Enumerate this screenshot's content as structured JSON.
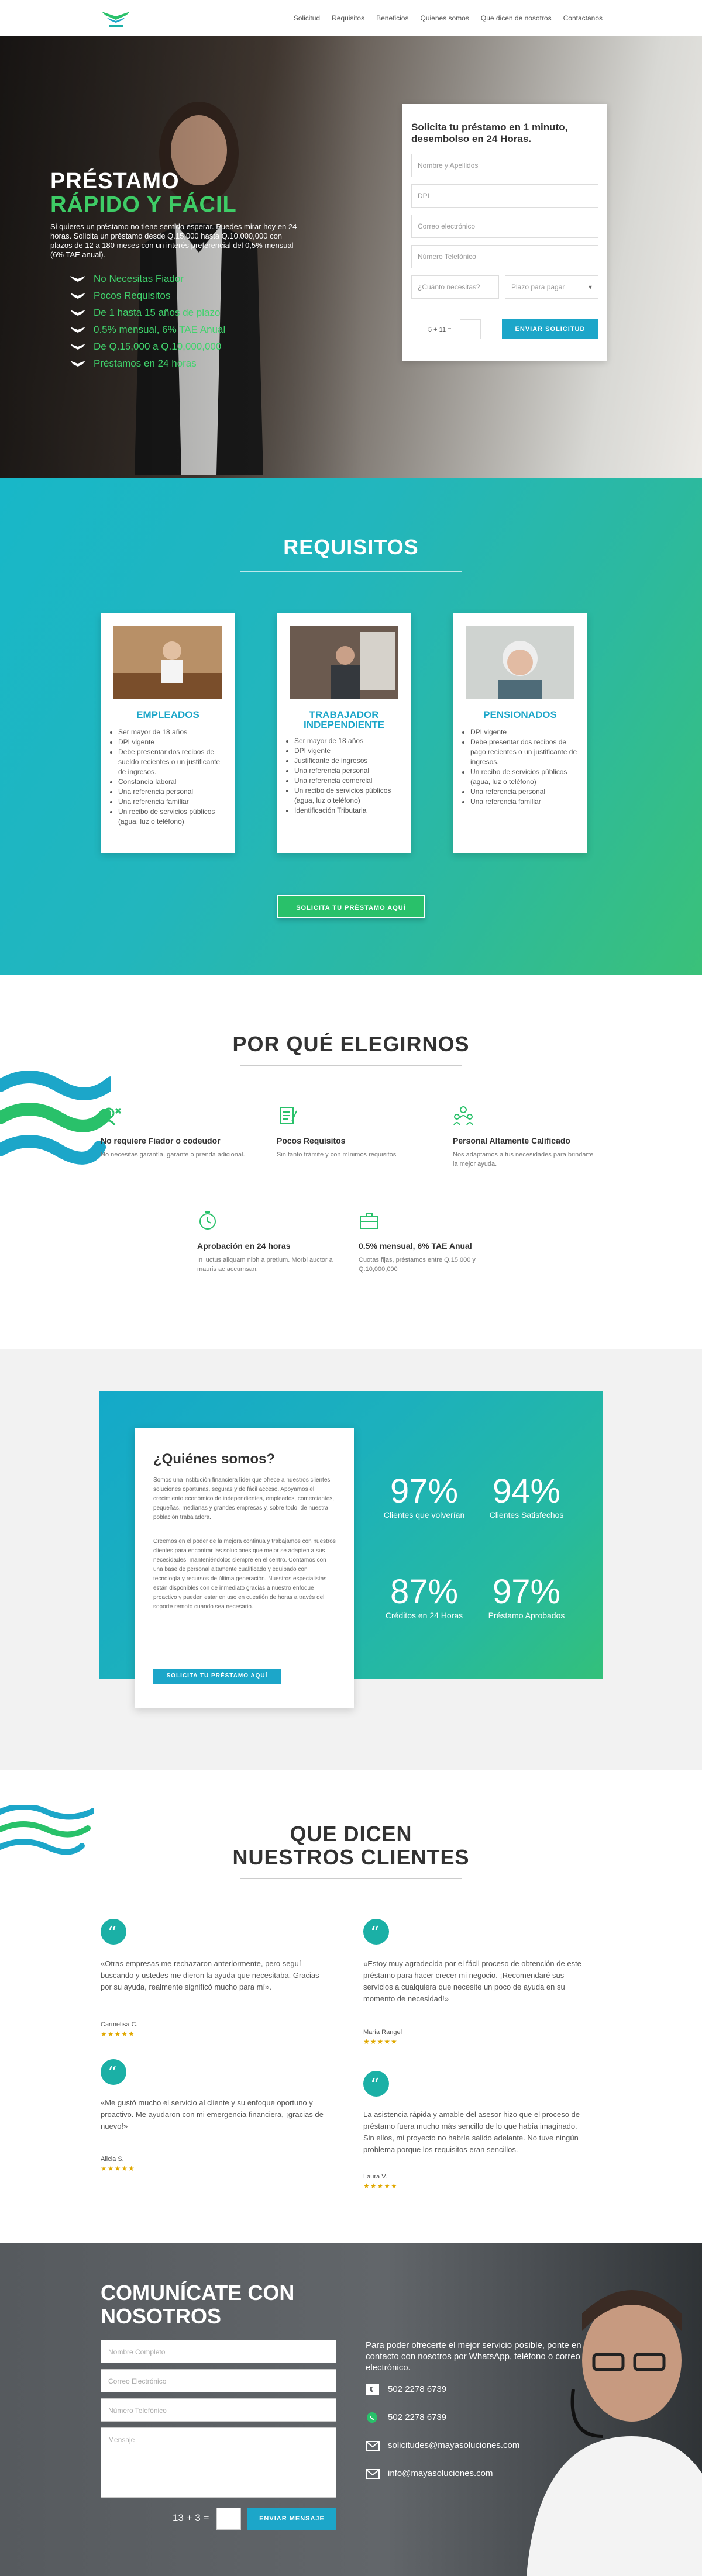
{
  "colors": {
    "green": "#29c16a",
    "teal": "#1ca6c9",
    "accent": "#1bb0a6"
  },
  "nav": {
    "items": [
      "Solicitud",
      "Requisitos",
      "Beneficios",
      "Quienes somos",
      "Que dicen de nosotros",
      "Contactanos"
    ]
  },
  "hero": {
    "title_line1": "PRÉSTAMO",
    "title_line2": "RÁPIDO Y FÁCIL",
    "intro": "Si quieres un préstamo no tiene sentido esperar. Puedes mirar hoy en 24 horas. Solicita un préstamo desde Q.15,000 hasta Q.10,000,000 con plazos de 12 a 180 meses con un interés preferencial del 0,5% mensual (6% TAE anual).",
    "bullets": [
      "No Necesitas Fiador",
      "Pocos Requisitos",
      "De 1 hasta 15 años de plazo",
      "0.5% mensual, 6% TAE Anual",
      "De Q.15,000 a Q.10,000,000",
      "Préstamos en 24 horas"
    ]
  },
  "form": {
    "title": "Solicita tu préstamo en 1 minuto, desembolso en 24 Horas.",
    "name_placeholder": "Nombre y Apellidos",
    "dpi_placeholder": "DPI",
    "email_placeholder": "Correo electrónico",
    "phone_placeholder": "Número Telefónico",
    "amount_placeholder": "¿Cuánto necesitas?",
    "term_placeholder": "Plazo para pagar",
    "captcha": "5 + 11 =",
    "submit": "ENVIAR SOLICITUD"
  },
  "requisitos": {
    "title": "REQUISITOS",
    "cards": [
      {
        "title": "EMPLEADOS",
        "items": [
          "Ser mayor de 18 años",
          "DPI vigente",
          "Debe presentar dos recibos de sueldo recientes o un justificante de ingresos.",
          "Constancia laboral",
          "Una referencia personal",
          "Una referencia familiar",
          "Un recibo de servicios públicos (agua, luz o teléfono)"
        ]
      },
      {
        "title": "TRABAJADOR INDEPENDIENTE",
        "items": [
          "Ser mayor de 18 años",
          "DPI vigente",
          "Justificante de ingresos",
          "Una referencia personal",
          "Una referencia comercial",
          "Un recibo de servicios públicos (agua, luz o teléfono)",
          "Identificación Tributaria"
        ]
      },
      {
        "title": "PENSIONADOS",
        "items": [
          "DPI vigente",
          "Debe presentar dos recibos de pago recientes o un justificante de ingresos.",
          "Un recibo de servicios públicos (agua, luz o teléfono)",
          "Una referencia personal",
          "Una referencia familiar"
        ]
      }
    ],
    "cta": "SOLICITA TU PRÉSTAMO AQUÍ"
  },
  "why": {
    "title": "POR QUÉ ELEGIRNOS",
    "features": [
      {
        "icon": "no-guarantor-icon",
        "title": "No requiere Fiador o codeudor",
        "text": "No necesitas garantía, garante o prenda adicional."
      },
      {
        "icon": "document-icon",
        "title": "Pocos Requisitos",
        "text": "Sin tanto trámite y con mínimos requisitos"
      },
      {
        "icon": "team-icon",
        "title": "Personal Altamente Calificado",
        "text": "Nos adaptamos a tus necesidades para brindarte la mejor ayuda."
      },
      {
        "icon": "clock-icon",
        "title": "Aprobación en 24 horas",
        "text": "In luctus aliquam nibh a pretium. Morbi auctor a mauris ac accumsan."
      },
      {
        "icon": "briefcase-icon",
        "title": "0.5% mensual, 6% TAE Anual",
        "text": "Cuotas fijas, préstamos entre Q.15,000 y Q.10,000,000"
      }
    ]
  },
  "about": {
    "title": "¿Quiénes somos?",
    "p1": "Somos una institución financiera líder que ofrece a nuestros clientes soluciones oportunas, seguras y de fácil acceso. Apoyamos el crecimiento económico de independientes, empleados, comerciantes, pequeñas, medianas y grandes empresas y, sobre todo, de nuestra población trabajadora.",
    "p2": "Creemos en el poder de la mejora continua y trabajamos con nuestros clientes para encontrar las soluciones que mejor se adapten a sus necesidades, manteniéndolos siempre en el centro. Contamos con una base de personal altamente cualificado y equipado con tecnología y recursos de última generación. Nuestros especialistas están disponibles con de inmediato gracias a nuestro enfoque proactivo y pueden estar en uso en cuestión de horas a través del soporte remoto cuando sea necesario.",
    "cta": "SOLICITA TU PRÉSTAMO AQUÍ",
    "stats": [
      {
        "value": "97%",
        "label": "Clientes que volverían"
      },
      {
        "value": "94%",
        "label": "Clientes Satisfechos"
      },
      {
        "value": "87%",
        "label": "Créditos en 24 Horas"
      },
      {
        "value": "97%",
        "label": "Préstamo Aprobados"
      }
    ]
  },
  "testimonials": {
    "title_line1": "QUE DICEN",
    "title_line2": "NUESTROS CLIENTES",
    "items": [
      {
        "quote": "«Otras empresas me rechazaron anteriormente, pero seguí buscando y ustedes me dieron la ayuda que necesitaba. Gracias por su ayuda, realmente significó mucho para mí».",
        "name": "Carmelisa C.",
        "stars": "★★★★★"
      },
      {
        "quote": "«Estoy muy agradecida por el fácil proceso de obtención de este préstamo para hacer crecer mi negocio. ¡Recomendaré sus servicios a cualquiera que necesite un poco de ayuda en su momento de necesidad!»",
        "name": "María Rangel",
        "stars": "★★★★★"
      },
      {
        "quote": "«Me gustó mucho el servicio al cliente y su enfoque oportuno y proactivo. Me ayudaron con mi emergencia financiera, ¡gracias de nuevo!»",
        "name": "Alicia S.",
        "stars": "★★★★★"
      },
      {
        "quote": "La asistencia rápida y amable del asesor hizo que el proceso de préstamo fuera mucho más sencillo de lo que había imaginado. Sin ellos, mi proyecto no habría salido adelante. No tuve ningún problema porque los requisitos eran sencillos.",
        "name": "Laura V.",
        "stars": "★★★★★"
      }
    ]
  },
  "contact": {
    "title": "COMUNÍCATE CON NOSOTROS",
    "name_placeholder": "Nombre Completo",
    "email_placeholder": "Correo Electrónico",
    "phone_placeholder": "Número Telefónico",
    "message_placeholder": "Mensaje",
    "captcha": "13 + 3 =",
    "submit": "ENVIAR MENSAJE",
    "intro": "Para poder ofrecerte el mejor servicio posible, ponte en contacto con nosotros por WhatsApp, teléfono o correo electrónico.",
    "phone": "502 2278 6739",
    "whatsapp": "502 2278 6739",
    "email1": "solicitudes@mayasoluciones.com",
    "email2": "info@mayasoluciones.com"
  }
}
